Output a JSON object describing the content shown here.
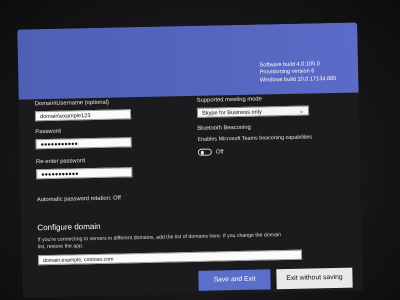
{
  "build_info": {
    "software_build": "Software build 4.0.105.0",
    "provisioning_version": "Provisioning version 6",
    "windows_build": "Windows build 10.0.17134.885"
  },
  "form": {
    "domain_username_label": "Domain\\Username (optional)",
    "domain_username_value": "domain\\example123",
    "password_label": "Password",
    "password_value": "●●●●●●●●●●●",
    "reenter_password_label": "Re-enter password",
    "reenter_password_value": "●●●●●●●●●●●",
    "password_rotation_label": "Automatic password rotation: Off"
  },
  "meeting_mode": {
    "label": "Supported meeting mode",
    "selected": "Skype for Business only"
  },
  "bluetooth": {
    "title": "Bluetooth Beaconing",
    "description": "Enables Microsoft Teams beaconing capabilities",
    "toggle_state": "Off"
  },
  "configure_domain": {
    "title": "Configure domain",
    "description": "If you're connecting to servers in different domains, add the list of domains here. If you change the domain list, restore the app.",
    "value": "domain.example, contoso.com"
  },
  "buttons": {
    "save_exit": "Save and Exit",
    "exit_without_saving": "Exit without saving"
  }
}
